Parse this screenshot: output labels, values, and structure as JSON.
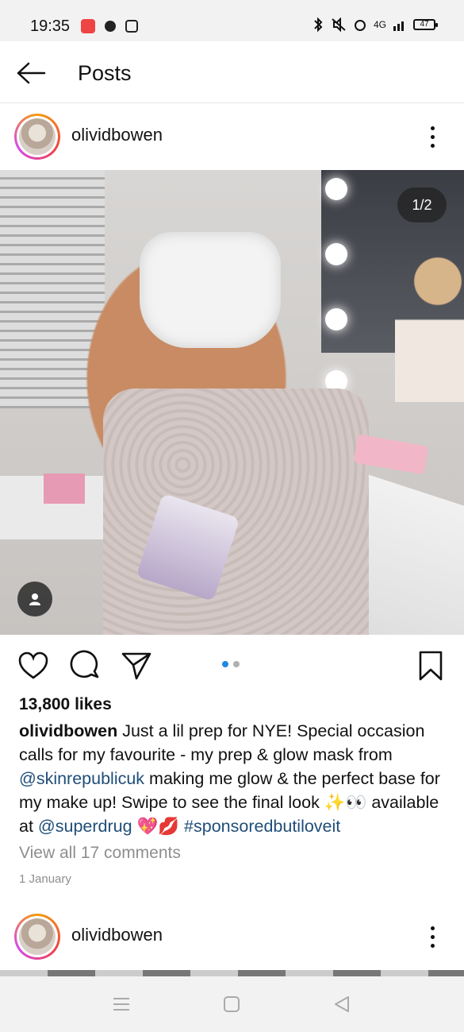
{
  "status_bar": {
    "time": "19:35",
    "battery": "47",
    "network": "4G"
  },
  "header": {
    "title": "Posts"
  },
  "post": {
    "username": "olividbowen",
    "image_counter": "1/2",
    "likes": "13,800 likes",
    "caption": {
      "user": "olividbowen",
      "text_1": " Just a lil prep for NYE! Special occasion calls for my favourite - my prep & glow mask from ",
      "mention_1": "@skinrepublicuk",
      "text_2": " making me glow & the perfect base for my make up! Swipe to see the final look ✨👀 available at ",
      "mention_2": "@superdrug",
      "text_3": " 💖💋 ",
      "hashtag": "#sponsoredbutiloveit"
    },
    "view_comments": "View all 17 comments",
    "date": "1 January",
    "carousel_dots": [
      {
        "color": "#1e88e5"
      },
      {
        "color": "#b0b0b0"
      }
    ]
  },
  "next_post": {
    "username": "olividbowen"
  },
  "colors": {
    "accent_blue": "#1e88e5",
    "link_blue": "#1f4e79",
    "muted_gray": "#8e8e8e"
  }
}
